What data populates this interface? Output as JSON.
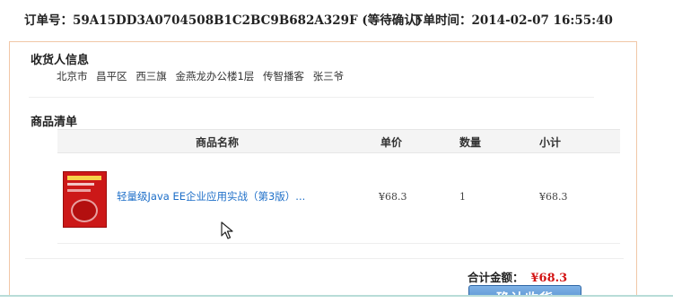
{
  "order": {
    "number_label": "订单号：",
    "number_value": "59A15DD3A0704508B1C2BC9B682A329F",
    "status": "(等待确认)",
    "time_label": "下单时间：",
    "time_value": "2014-02-07 16:55:40"
  },
  "receiver": {
    "title": "收货人信息",
    "city": "北京市",
    "district": "昌平区",
    "area": "西三旗",
    "building": "金燕龙办公楼1层",
    "company": "传智播客",
    "name": "张三爷"
  },
  "items": {
    "title": "商品清单",
    "headers": {
      "name": "商品名称",
      "price": "单价",
      "quantity": "数量",
      "subtotal": "小计"
    },
    "rows": [
      {
        "name": "轻量级Java EE企业应用实战（第3版）...",
        "price": "¥68.3",
        "quantity": "1",
        "subtotal": "¥68.3"
      }
    ]
  },
  "summary": {
    "total_label": "合计金额：",
    "total_value": "¥68.3",
    "confirm_label": "确认收货"
  },
  "colors": {
    "panel_border": "#f1c7a7",
    "link": "#1c6ec8",
    "price_red": "#d31414",
    "button_blue": "#3e7cc3"
  },
  "icons": {
    "cursor": "mouse-pointer-icon",
    "thumbnail": "book-cover-thumbnail"
  }
}
